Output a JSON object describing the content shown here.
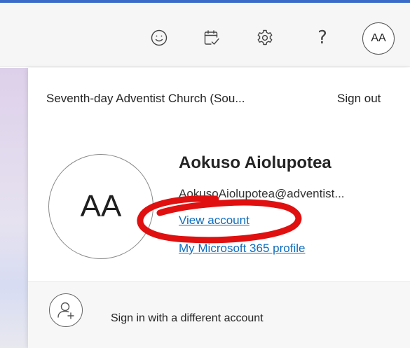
{
  "header": {
    "icons": {
      "feedback": "smiley-face-icon",
      "calendar": "calendar-check-icon",
      "settings": "gear-icon",
      "help": "question-mark-icon"
    },
    "help_glyph": "?",
    "avatar_initials": "AA"
  },
  "account_panel": {
    "organization": "Seventh-day Adventist Church (Sou...",
    "sign_out": "Sign out",
    "avatar_initials": "AA",
    "user_name": "Aokuso Aiolupotea",
    "email": "AokusoAiolupotea@adventist...",
    "view_account": "View account",
    "microsoft_profile": "My Microsoft 365 profile",
    "sign_in_different": "Sign in with a different account"
  },
  "colors": {
    "accent": "#3a6bc7",
    "link": "#0f6cbd",
    "annotation": "#e01010"
  }
}
